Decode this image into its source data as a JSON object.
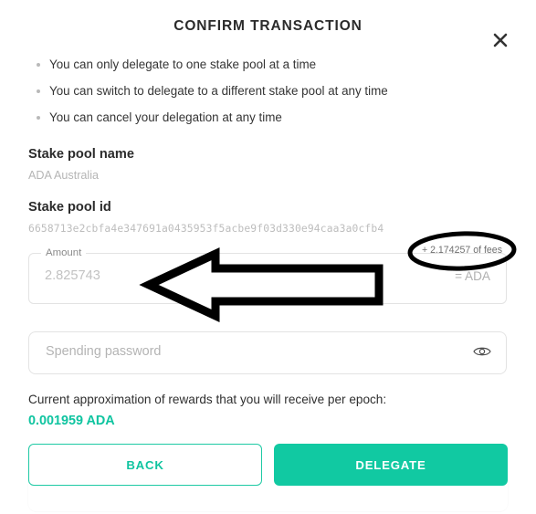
{
  "dialog": {
    "title": "CONFIRM TRANSACTION",
    "close_icon": "close-icon"
  },
  "info_bullets": [
    "You can only delegate to one stake pool at a time",
    "You can switch to delegate to a different stake pool at any time",
    "You can cancel your delegation at any time"
  ],
  "stake_pool": {
    "name_label": "Stake pool name",
    "name_value": "ADA Australia",
    "id_label": "Stake pool id",
    "id_value": "6658713e2cbfa4e347691a0435953f5acbe9f03d330e94caa3a0cfb4"
  },
  "amount_field": {
    "label": "Amount",
    "value": "2.825743",
    "placeholder": "2.825743",
    "unit": "= ADA",
    "fees_note": "+ 2.174257 of fees"
  },
  "password_field": {
    "placeholder": "Spending password",
    "value": "",
    "reveal_icon": "eye-icon"
  },
  "rewards": {
    "description": "Current approximation of rewards that you will receive per epoch:",
    "amount": "0.001959 ADA"
  },
  "actions": {
    "back_label": "BACK",
    "delegate_label": "DELEGATE"
  },
  "colors": {
    "accent": "#11c9a2",
    "accent_text": "#0fc4a0",
    "title_text": "#2b2b2b",
    "muted_text": "#b5b5b5",
    "annotation": "#000000"
  },
  "annotations": {
    "arrow": "left-pointing-arrow",
    "ellipse": "ellipse-around-fees"
  }
}
